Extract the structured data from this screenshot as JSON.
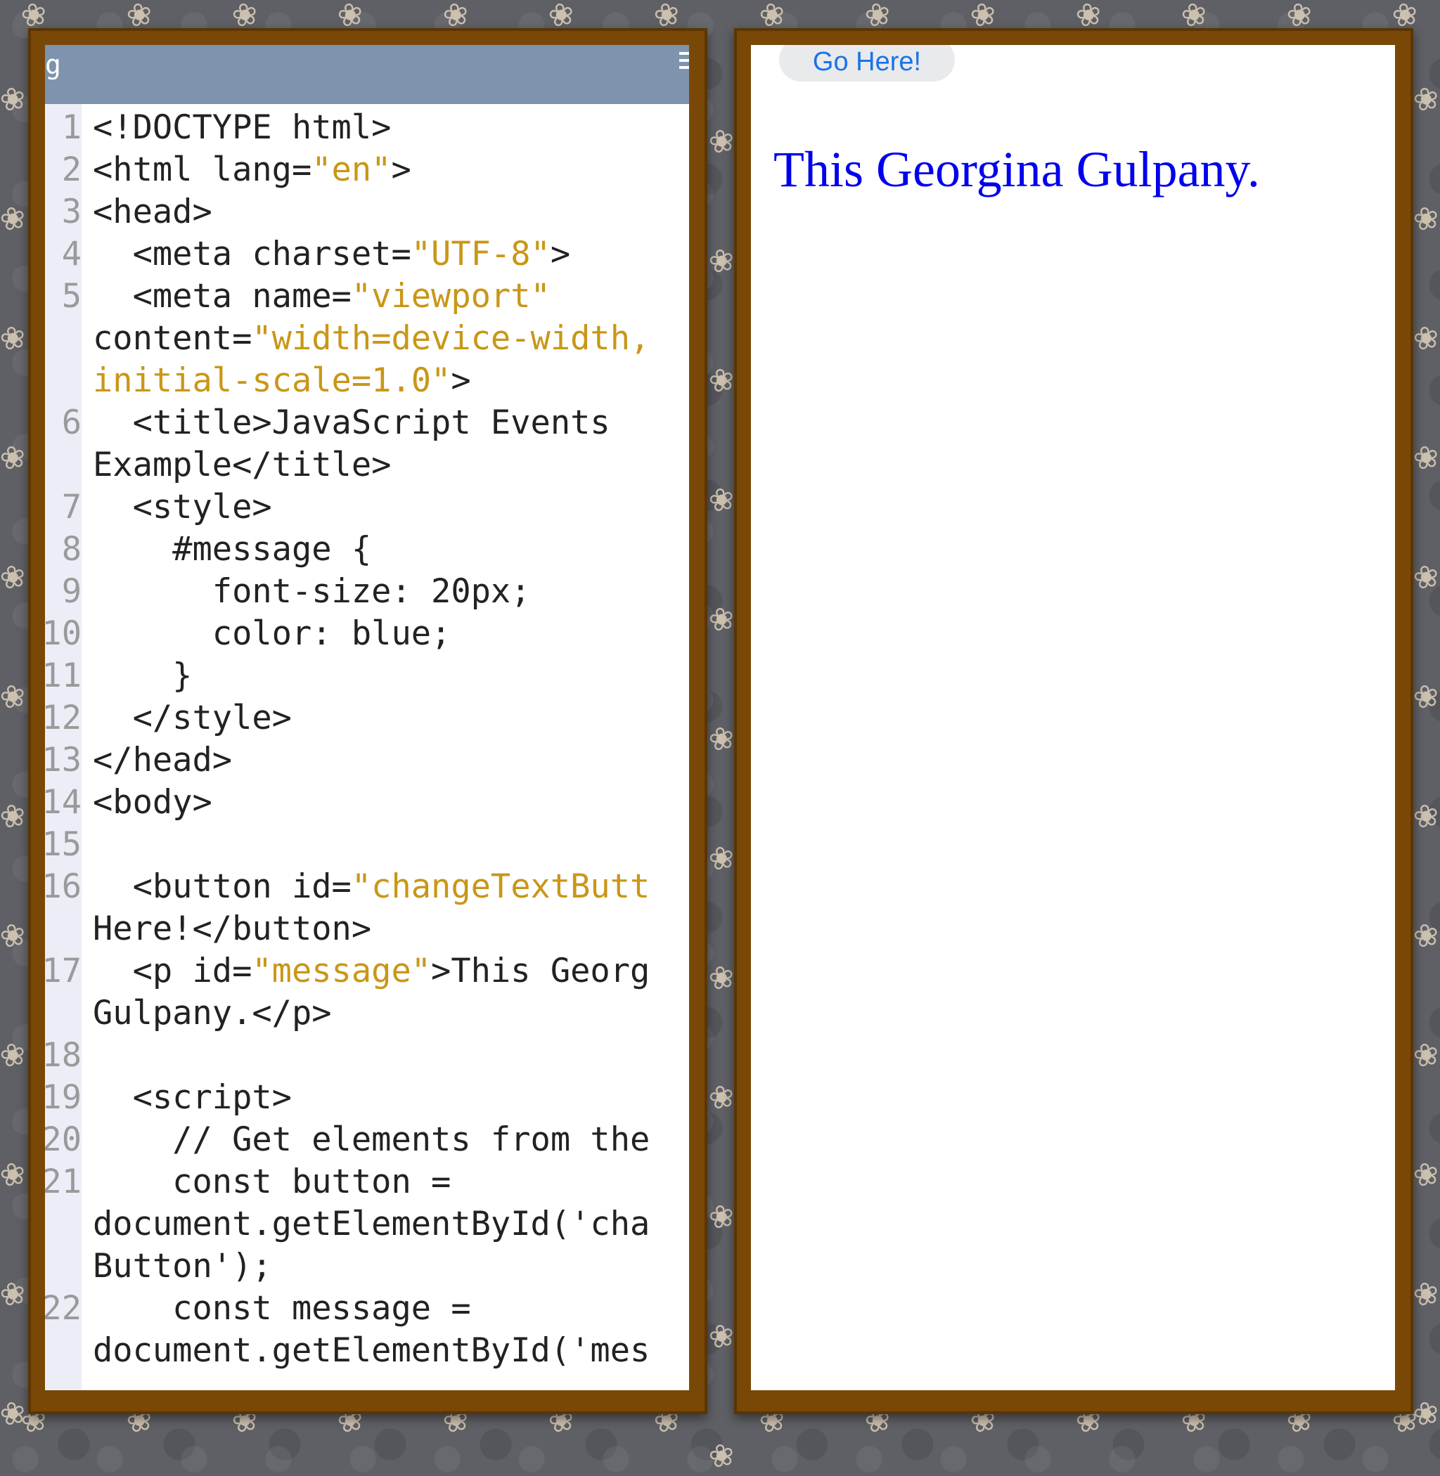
{
  "editor": {
    "header_glyph": "g",
    "code_lines": [
      {
        "no": "1",
        "tokens": [
          {
            "t": "<!DOCTYPE html>"
          }
        ]
      },
      {
        "no": "2",
        "tokens": [
          {
            "t": "<html lang="
          },
          {
            "t": "\"en\"",
            "s": true
          },
          {
            "t": ">"
          }
        ]
      },
      {
        "no": "3",
        "tokens": [
          {
            "t": "<head>"
          }
        ]
      },
      {
        "no": "4",
        "tokens": [
          {
            "t": "  <meta charset="
          },
          {
            "t": "\"UTF-8\"",
            "s": true
          },
          {
            "t": ">"
          }
        ]
      },
      {
        "no": "5",
        "tokens": [
          {
            "t": "  <meta name="
          },
          {
            "t": "\"viewport\"",
            "s": true
          }
        ]
      },
      {
        "no": "",
        "tokens": [
          {
            "t": "content="
          },
          {
            "t": "\"width=device-width,",
            "s": true
          }
        ]
      },
      {
        "no": "",
        "tokens": [
          {
            "t": "initial-scale=1.0\"",
            "s": true
          },
          {
            "t": ">"
          }
        ]
      },
      {
        "no": "6",
        "tokens": [
          {
            "t": "  <title>JavaScript Events"
          }
        ]
      },
      {
        "no": "",
        "tokens": [
          {
            "t": "Example</title>"
          }
        ]
      },
      {
        "no": "7",
        "tokens": [
          {
            "t": "  <style>"
          }
        ]
      },
      {
        "no": "8",
        "tokens": [
          {
            "t": "    #message {"
          }
        ]
      },
      {
        "no": "9",
        "tokens": [
          {
            "t": "      font-size: 20px;"
          }
        ]
      },
      {
        "no": "10",
        "tokens": [
          {
            "t": "      color: blue;"
          }
        ]
      },
      {
        "no": "11",
        "tokens": [
          {
            "t": "    }"
          }
        ]
      },
      {
        "no": "12",
        "tokens": [
          {
            "t": "  </style>"
          }
        ]
      },
      {
        "no": "13",
        "tokens": [
          {
            "t": "</head>"
          }
        ]
      },
      {
        "no": "14",
        "tokens": [
          {
            "t": "<body>"
          }
        ]
      },
      {
        "no": "15",
        "tokens": [
          {
            "t": ""
          }
        ]
      },
      {
        "no": "16",
        "tokens": [
          {
            "t": "  <button id="
          },
          {
            "t": "\"changeTextButt",
            "s": true
          }
        ]
      },
      {
        "no": "",
        "tokens": [
          {
            "t": "Here!</button>"
          }
        ]
      },
      {
        "no": "17",
        "tokens": [
          {
            "t": "  <p id="
          },
          {
            "t": "\"message\"",
            "s": true
          },
          {
            "t": ">This Georg"
          }
        ]
      },
      {
        "no": "",
        "tokens": [
          {
            "t": "Gulpany.</p>"
          }
        ]
      },
      {
        "no": "18",
        "tokens": [
          {
            "t": ""
          }
        ]
      },
      {
        "no": "19",
        "tokens": [
          {
            "t": "  <script>"
          }
        ]
      },
      {
        "no": "20",
        "tokens": [
          {
            "t": "    // Get elements from the"
          }
        ]
      },
      {
        "no": "21",
        "tokens": [
          {
            "t": "    const button ="
          }
        ]
      },
      {
        "no": "",
        "tokens": [
          {
            "t": "document.getElementById('cha"
          }
        ]
      },
      {
        "no": "",
        "tokens": [
          {
            "t": "Button');"
          }
        ]
      },
      {
        "no": "22",
        "tokens": [
          {
            "t": "    const message ="
          }
        ]
      },
      {
        "no": "",
        "tokens": [
          {
            "t": "document.getElementById('mes"
          }
        ]
      }
    ]
  },
  "preview": {
    "button_label": "Go Here!",
    "message_text": "This Georgina Gulpany."
  },
  "colors": {
    "frame": "#7a4806",
    "editor_header": "#7e93ad",
    "gutter": "#eceef7",
    "string_token": "#c99717",
    "message_text": "#0000ee",
    "button_text": "#1a73e8"
  },
  "icons": {
    "menu": "hamburger-menu-icon",
    "background": "butterfly-icon"
  }
}
